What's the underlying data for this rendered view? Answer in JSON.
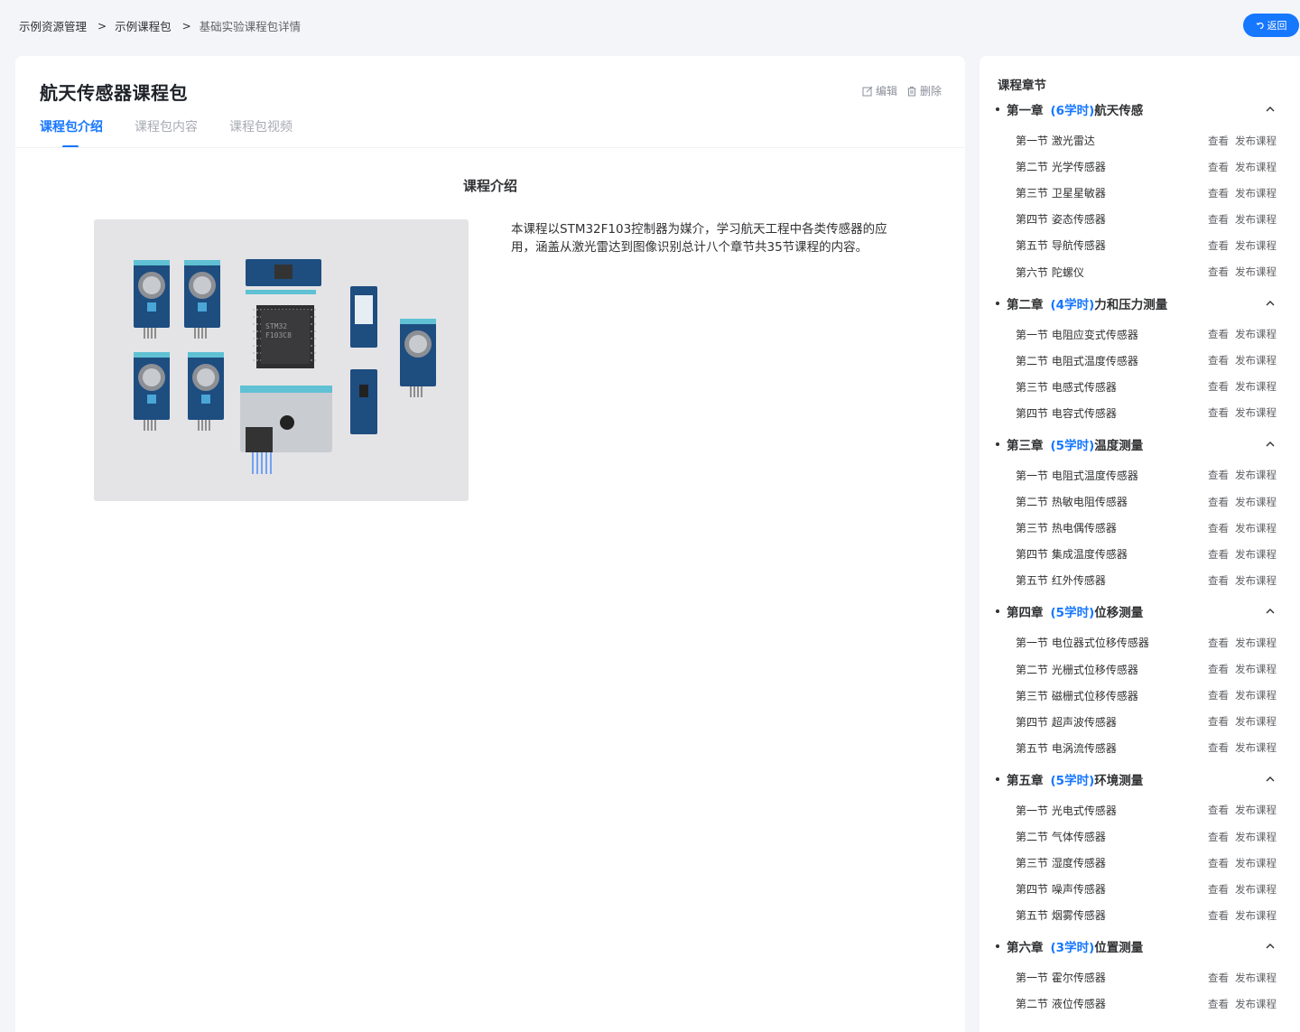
{
  "breadcrumb": {
    "items": [
      "示例资源管理",
      "示例课程包",
      "基础实验课程包详情"
    ],
    "separator": ">"
  },
  "back_button": {
    "label": "返回",
    "icon": "return-icon"
  },
  "package": {
    "title": "航天传感器课程包",
    "actions": {
      "edit": "编辑",
      "delete": "删除"
    },
    "tabs": [
      "课程包介绍",
      "课程包内容",
      "课程包视频"
    ],
    "active_tab": 0,
    "intro_heading": "课程介绍",
    "image_alt": "sensor modules and STM32F103C8 controller",
    "description": "本课程以STM32F103控制器为媒介，学习航天工程中各类传感器的应用，涵盖从激光雷达到图像识别总计八个章节共35节课程的内容。"
  },
  "sidebar": {
    "title": "课程章节",
    "view_label": "查看",
    "publish_label": "发布课程",
    "chapters": [
      {
        "num": "第一章",
        "hours": "(6学时)",
        "name": "航天传感",
        "sections": [
          {
            "num": "第一节",
            "name": "激光雷达"
          },
          {
            "num": "第二节",
            "name": "光学传感器"
          },
          {
            "num": "第三节",
            "name": "卫星星敏器"
          },
          {
            "num": "第四节",
            "name": "姿态传感器"
          },
          {
            "num": "第五节",
            "name": "导航传感器"
          },
          {
            "num": "第六节",
            "name": "陀螺仪"
          }
        ]
      },
      {
        "num": "第二章",
        "hours": "(4学时)",
        "name": "力和压力测量",
        "sections": [
          {
            "num": "第一节",
            "name": "电阻应变式传感器"
          },
          {
            "num": "第二节",
            "name": "电阻式温度传感器"
          },
          {
            "num": "第三节",
            "name": "电感式传感器"
          },
          {
            "num": "第四节",
            "name": "电容式传感器"
          }
        ]
      },
      {
        "num": "第三章",
        "hours": "(5学时)",
        "name": "温度测量",
        "sections": [
          {
            "num": "第一节",
            "name": "电阻式温度传感器"
          },
          {
            "num": "第二节",
            "name": "热敏电阻传感器"
          },
          {
            "num": "第三节",
            "name": "热电偶传感器"
          },
          {
            "num": "第四节",
            "name": "集成温度传感器"
          },
          {
            "num": "第五节",
            "name": "红外传感器"
          }
        ]
      },
      {
        "num": "第四章",
        "hours": "(5学时)",
        "name": "位移测量",
        "sections": [
          {
            "num": "第一节",
            "name": "电位器式位移传感器"
          },
          {
            "num": "第二节",
            "name": "光栅式位移传感器"
          },
          {
            "num": "第三节",
            "name": "磁栅式位移传感器"
          },
          {
            "num": "第四节",
            "name": "超声波传感器"
          },
          {
            "num": "第五节",
            "name": "电涡流传感器"
          }
        ]
      },
      {
        "num": "第五章",
        "hours": "(5学时)",
        "name": "环境测量",
        "sections": [
          {
            "num": "第一节",
            "name": "光电式传感器"
          },
          {
            "num": "第二节",
            "name": "气体传感器"
          },
          {
            "num": "第三节",
            "name": "湿度传感器"
          },
          {
            "num": "第四节",
            "name": "噪声传感器"
          },
          {
            "num": "第五节",
            "name": "烟雾传感器"
          }
        ]
      },
      {
        "num": "第六章",
        "hours": "(3学时)",
        "name": "位置测量",
        "sections": [
          {
            "num": "第一节",
            "name": "霍尔传感器"
          },
          {
            "num": "第二节",
            "name": "液位传感器"
          }
        ]
      }
    ]
  },
  "colors": {
    "accent": "#1677ff",
    "page_bg": "#f3f5f9",
    "card_bg": "#ffffff"
  }
}
